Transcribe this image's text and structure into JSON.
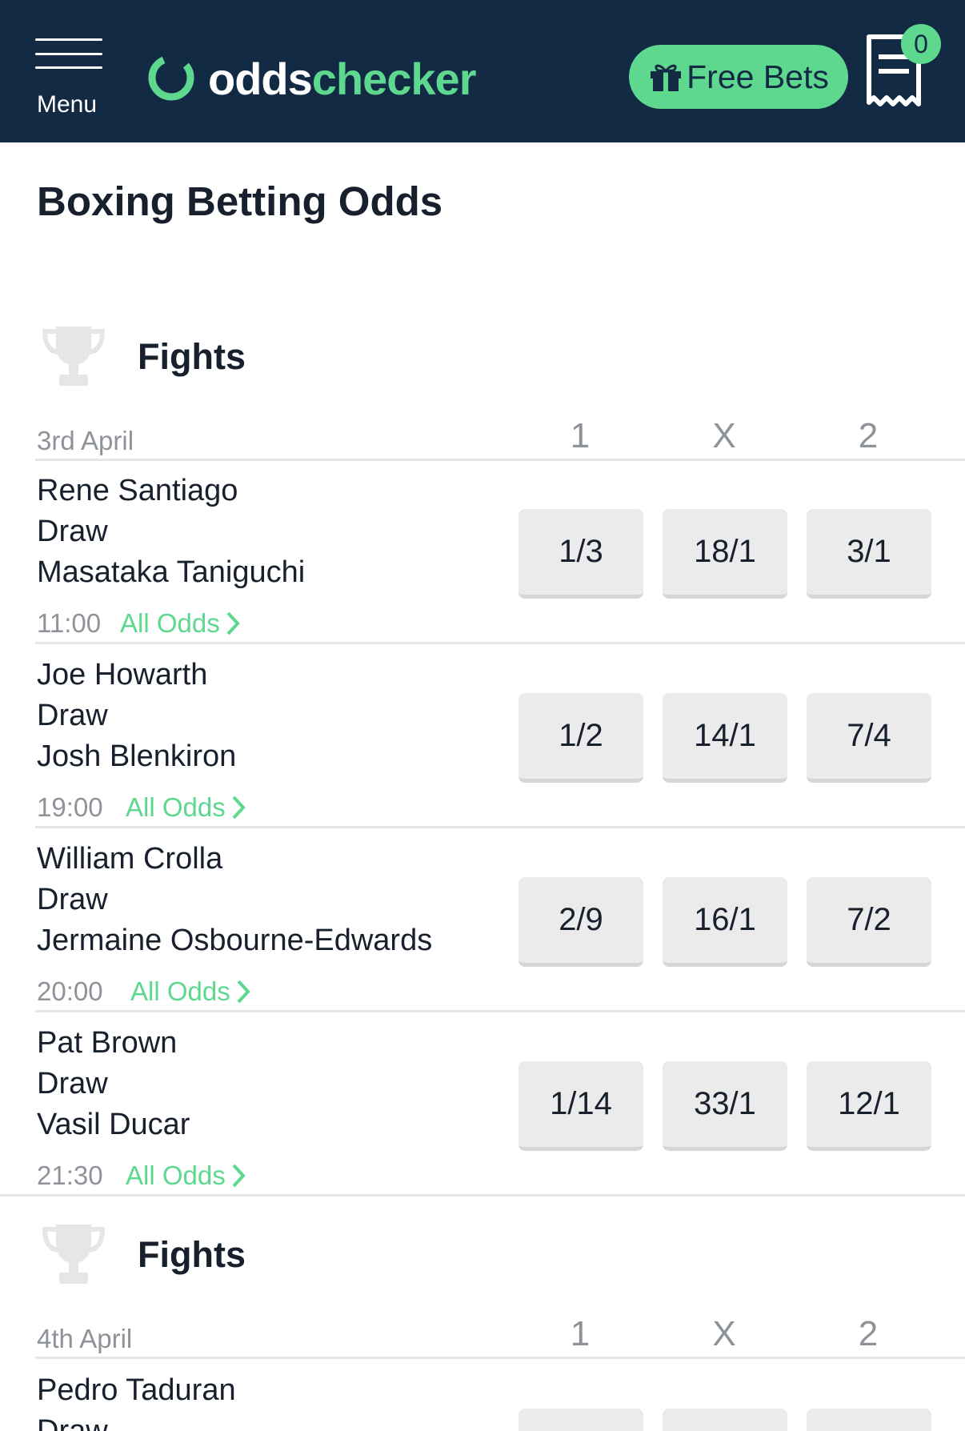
{
  "header": {
    "menu_label": "Menu",
    "logo_part1": "odds",
    "logo_part2": "checker",
    "free_bets_label": "Free Bets",
    "betslip_count": "0",
    "colors": {
      "navy": "#132a44",
      "green": "#5ed88f"
    }
  },
  "page_title": "Boxing Betting Odds",
  "sections": [
    {
      "title": "Fights",
      "date": "3rd April",
      "col1": "1",
      "colX": "X",
      "col2": "2",
      "events": [
        {
          "home": "Rene Santiago",
          "draw": "Draw",
          "away": "Masataka Taniguchi",
          "time": "11:00",
          "all_odds": "All Odds",
          "odds": [
            "1/3",
            "18/1",
            "3/1"
          ]
        },
        {
          "home": "Joe Howarth",
          "draw": "Draw",
          "away": "Josh Blenkiron",
          "time": "19:00",
          "all_odds": "All Odds",
          "odds": [
            "1/2",
            "14/1",
            "7/4"
          ]
        },
        {
          "home": "William Crolla",
          "draw": "Draw",
          "away": "Jermaine Osbourne-Edwards",
          "time": "20:00",
          "all_odds": "All Odds",
          "odds": [
            "2/9",
            "16/1",
            "7/2"
          ]
        },
        {
          "home": "Pat Brown",
          "draw": "Draw",
          "away": "Vasil Ducar",
          "time": "21:30",
          "all_odds": "All Odds",
          "odds": [
            "1/14",
            "33/1",
            "12/1"
          ]
        }
      ]
    },
    {
      "title": "Fights",
      "date": "4th April",
      "col1": "1",
      "colX": "X",
      "col2": "2",
      "events": [
        {
          "home": "Pedro Taduran",
          "draw": "Draw"
        }
      ]
    }
  ]
}
